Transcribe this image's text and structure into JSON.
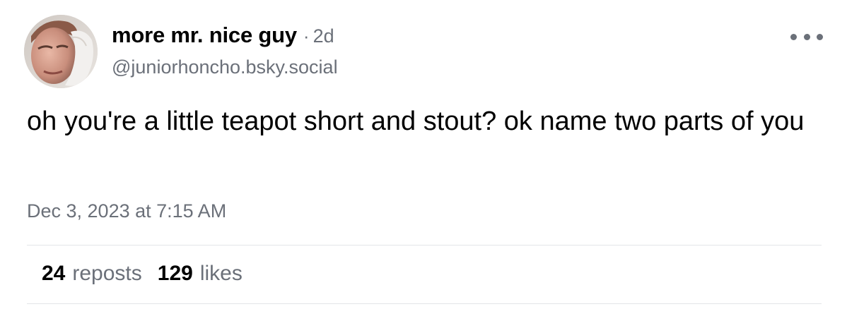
{
  "author": {
    "display_name": "more mr. nice guy",
    "separator": "·",
    "age": "2d",
    "handle": "@juniorhoncho.bsky.social"
  },
  "post": {
    "text": "oh you're a little teapot short and stout? ok name two parts of you",
    "timestamp": "Dec 3, 2023 at 7:15 AM"
  },
  "stats": {
    "reposts_count": "24",
    "reposts_label": "reposts",
    "likes_count": "129",
    "likes_label": "likes"
  },
  "icons": {
    "more": "more-horizontal-icon"
  },
  "colors": {
    "muted_text": "#6b7079",
    "divider": "#e3e5e8",
    "background": "#ffffff"
  }
}
